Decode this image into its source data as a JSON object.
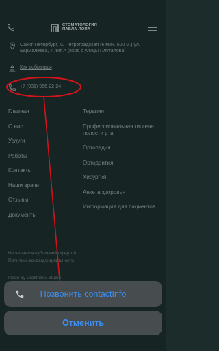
{
  "header": {
    "logo_line1": "СТОМАТОЛОГИЯ",
    "logo_line2": "ПАВЛА ЛОПА",
    "logo_mark": "П"
  },
  "contacts": {
    "address": "Санкт-Петербург, м. Петроградская (6 мин. 500 м.) ул. Бармалеева, 7 лит А (вход с улицы Плуталова)",
    "directions": "Как добраться",
    "phone": "+7 (931) 956-22-24"
  },
  "menu_left": [
    "Главная",
    "О нас",
    "Услуги",
    "Работы",
    "Контакты",
    "Наши врачи",
    "Отзывы",
    "Документы"
  ],
  "menu_right": [
    "Терапия",
    "Профессиональная гигиена полости рта",
    "Ортопедия",
    "Ортодонтия",
    "Хирургия",
    "Анкета здоровья",
    "Информация для пациентов"
  ],
  "footer": {
    "offer": "Не является публичной офертой",
    "privacy": "Политика конфиденциальности",
    "made_by": "made by Grokhotov Studio"
  },
  "action_sheet": {
    "call_label": "Позвонить contactInfo",
    "cancel_label": "Отменить"
  },
  "colors": {
    "background": "#1c2c2b",
    "annotation_red": "#d0141b",
    "ios_blue": "#3d8ef0"
  }
}
